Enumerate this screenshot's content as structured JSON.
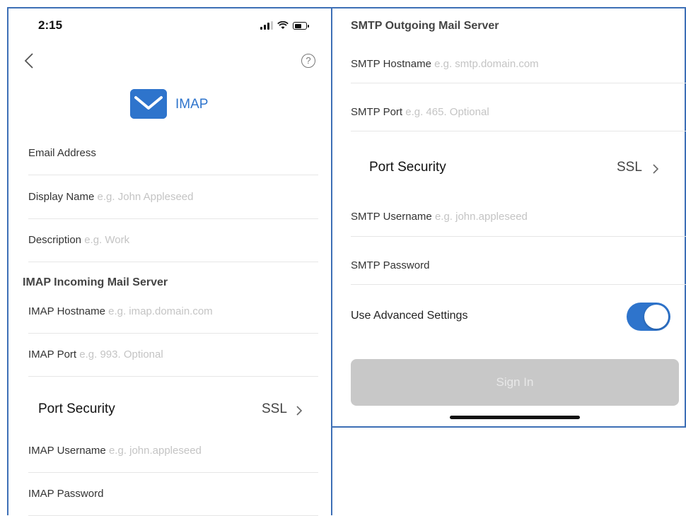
{
  "status_bar": {
    "time": "2:15"
  },
  "header": {
    "title": "IMAP",
    "help_icon": "question-circle-icon",
    "back_icon": "chevron-left-icon"
  },
  "account": {
    "email": {
      "label": "Email Address",
      "placeholder": ""
    },
    "display_name": {
      "label": "Display Name",
      "placeholder": "e.g. John Appleseed"
    },
    "description": {
      "label": "Description",
      "placeholder": "e.g. Work"
    }
  },
  "imap": {
    "section_title": "IMAP Incoming Mail Server",
    "hostname": {
      "label": "IMAP Hostname",
      "placeholder": "e.g. imap.domain.com"
    },
    "port": {
      "label": "IMAP Port",
      "placeholder": "e.g. 993. Optional"
    },
    "security": {
      "label": "Port Security",
      "value": "SSL"
    },
    "username": {
      "label": "IMAP Username",
      "placeholder": "e.g. john.appleseed"
    },
    "password": {
      "label": "IMAP Password"
    }
  },
  "smtp": {
    "section_title": "SMTP Outgoing Mail Server",
    "hostname": {
      "label": "SMTP Hostname",
      "placeholder": "e.g. smtp.domain.com"
    },
    "port": {
      "label": "SMTP Port",
      "placeholder": "e.g. 465. Optional"
    },
    "security": {
      "label": "Port Security",
      "value": "SSL"
    },
    "username": {
      "label": "SMTP Username",
      "placeholder": "e.g. john.appleseed"
    },
    "password": {
      "label": "SMTP Password"
    }
  },
  "advanced": {
    "label": "Use Advanced Settings",
    "enabled": true
  },
  "sign_in": {
    "label": "Sign In"
  },
  "colors": {
    "accent": "#2e74cc",
    "border": "#3d6fb6",
    "disabled_button": "#c8c8c8"
  }
}
